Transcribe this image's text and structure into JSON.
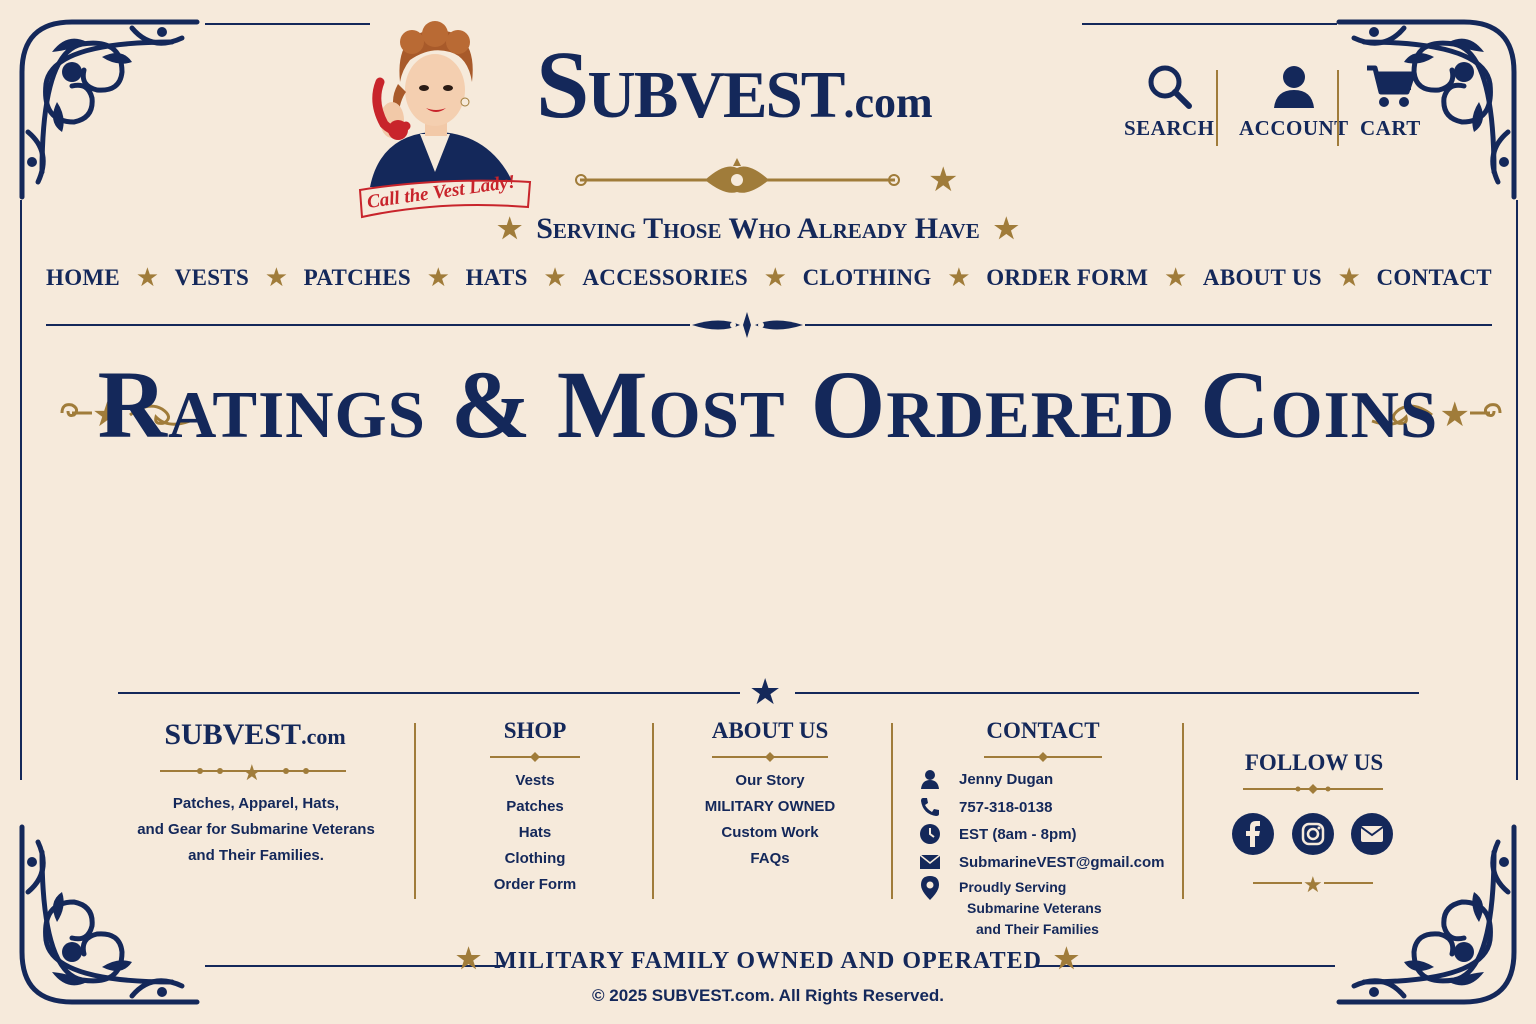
{
  "brand": {
    "name": "Subvest",
    "suffix": ".com",
    "mascot_caption": "Call the Vest Lady!"
  },
  "utility": {
    "search": "SEARCH",
    "account": "ACCOUNT",
    "cart": "CART"
  },
  "tagline": "Serving Those Who Already Have",
  "nav": [
    "HOME",
    "VESTS",
    "PATCHES",
    "HATS",
    "ACCESSORIES",
    "CLOTHING",
    "ORDER FORM",
    "ABOUT US",
    "CONTACT"
  ],
  "page_title": "Ratings & Most Ordered Coins",
  "footer": {
    "brand_name": "SUBVEST",
    "brand_suffix": ".com",
    "description": [
      "Patches, Apparel, Hats,",
      "and Gear for Submarine Veterans",
      "and Their Families."
    ],
    "shop": {
      "title": "SHOP",
      "links": [
        "Vests",
        "Patches",
        "Hats",
        "Clothing",
        "Order Form"
      ]
    },
    "about": {
      "title": "ABOUT US",
      "links": [
        "Our Story",
        "MILITARY OWNED",
        "Custom Work",
        "FAQs"
      ]
    },
    "contact": {
      "title": "CONTACT",
      "name": "Jenny Dugan",
      "phone": "757-318-0138",
      "hours": "EST (8am - 8pm)",
      "email": "SubmarineVEST@gmail.com",
      "location": [
        "Proudly Serving",
        "Submarine Veterans",
        "and Their Families"
      ]
    },
    "follow": {
      "title": "FOLLOW US",
      "icons": [
        "facebook-icon",
        "instagram-icon",
        "email-icon"
      ]
    },
    "bottom_tagline": "MILITARY FAMILY OWNED AND OPERATED",
    "copyright": "© 2025 SUBVEST.com. All Rights Reserved."
  },
  "colors": {
    "navy": "#14285a",
    "gold": "#a07c3a",
    "background": "#f6eadb",
    "red": "#c8242b"
  }
}
